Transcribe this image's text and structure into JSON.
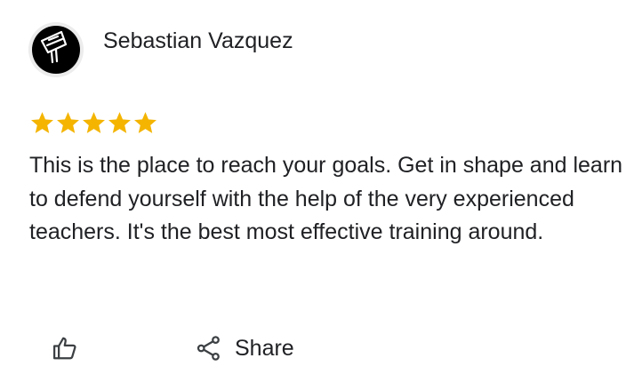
{
  "review": {
    "reviewer_name": "Sebastian Vazquez",
    "rating": 5,
    "max_rating": 5,
    "text": "This is the place to reach your goals. Get in shape and learn to defend yourself with the help of the very experienced teachers. It's the best most effective training around."
  },
  "actions": {
    "like_icon": "thumbs-up-icon",
    "share_icon": "share-icon",
    "share_label": "Share"
  },
  "colors": {
    "star": "#f4b400",
    "text": "#202124",
    "avatar_bg": "#000000"
  },
  "icons": {
    "avatar": "welding-helmet-icon"
  }
}
